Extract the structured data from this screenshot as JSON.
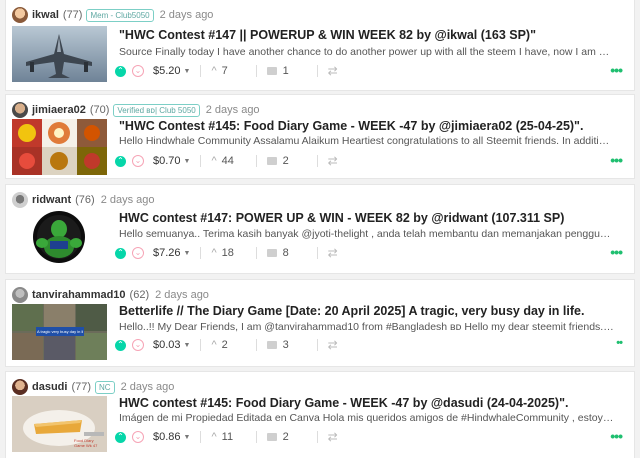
{
  "colors": {
    "upvote": "#06d6a9",
    "downvote": "#f6a4b6",
    "badge": "#7ccfc6",
    "more": "#1fbf70"
  },
  "posts": [
    {
      "author": "ikwal",
      "rep": "(77)",
      "badge": "Mem - Club5050",
      "time": "2 days ago",
      "title": "\"HWC Contest #147 || POWERUP & WIN WEEK 82 by @ikwal (163 SP)\"",
      "summary": "Source Finally today I have another chance to do another power up with all the steem I have, now I am getting…",
      "payout": "$5.20",
      "votes": "7",
      "comments": "1"
    },
    {
      "author": "jimiaera02",
      "rep": "(70)",
      "badge": "Verified ʙᴅ| Club 5050",
      "time": "2 days ago",
      "title": "\"HWC Contest #145: Food Diary Game - WEEK -47 by @jimiaera02 (25-04-25)\".",
      "summary": "Hello Hindwhale Community Assalamu Alaikum Heartiest congratulations to all Steemit friends. In addition to…",
      "payout": "$0.70",
      "votes": "44",
      "comments": "2"
    },
    {
      "author": "ridwant",
      "rep": "(76)",
      "badge": "",
      "time": "2 days ago",
      "title": "HWC contest #147: POWER UP & WIN - WEEK 82 by @ridwant (107.311 SP)",
      "summary": "Hello semuanya.. Terima kasih banyak @jyoti-thelight , anda telah membantu dan memanjakan pengguna platform den…",
      "payout": "$7.26",
      "votes": "18",
      "comments": "8"
    },
    {
      "author": "tanvirahammad10",
      "rep": "(62)",
      "badge": "",
      "time": "2 days ago",
      "title": "Betterlife // The Diary Game [Date: 20 April 2025] A tragic, very busy day in life.",
      "summary": "Hello..!! My Dear Friends, I am @tanvirahammad10 from #Bangladesh ʙᴅ Hello my dear steemit friends. I…",
      "payout": "$0.03",
      "votes": "2",
      "comments": "3",
      "thumb_text": "A tragic very busy day in life"
    },
    {
      "author": "dasudi",
      "rep": "(77)",
      "badge": "NC",
      "time": "2 days ago",
      "title": "HWC contest #145: Food Diary Game - WEEK -47 by @dasudi (24-04-2025)\".",
      "summary": "Imágen de mi Propiedad Editada en Canva Hola mis queridos amigos de #HindwhaleCommunity , estoy muy…",
      "payout": "$0.86",
      "votes": "11",
      "comments": "2",
      "thumb_text": "Food Diary Game Wk 47"
    }
  ],
  "icons": {
    "upvote": "chevron-up-icon",
    "downvote": "chevron-down-icon",
    "votes": "upvote-caret-icon",
    "comments": "comment-icon",
    "resteem": "resteem-icon",
    "more": "more-dots-icon"
  }
}
